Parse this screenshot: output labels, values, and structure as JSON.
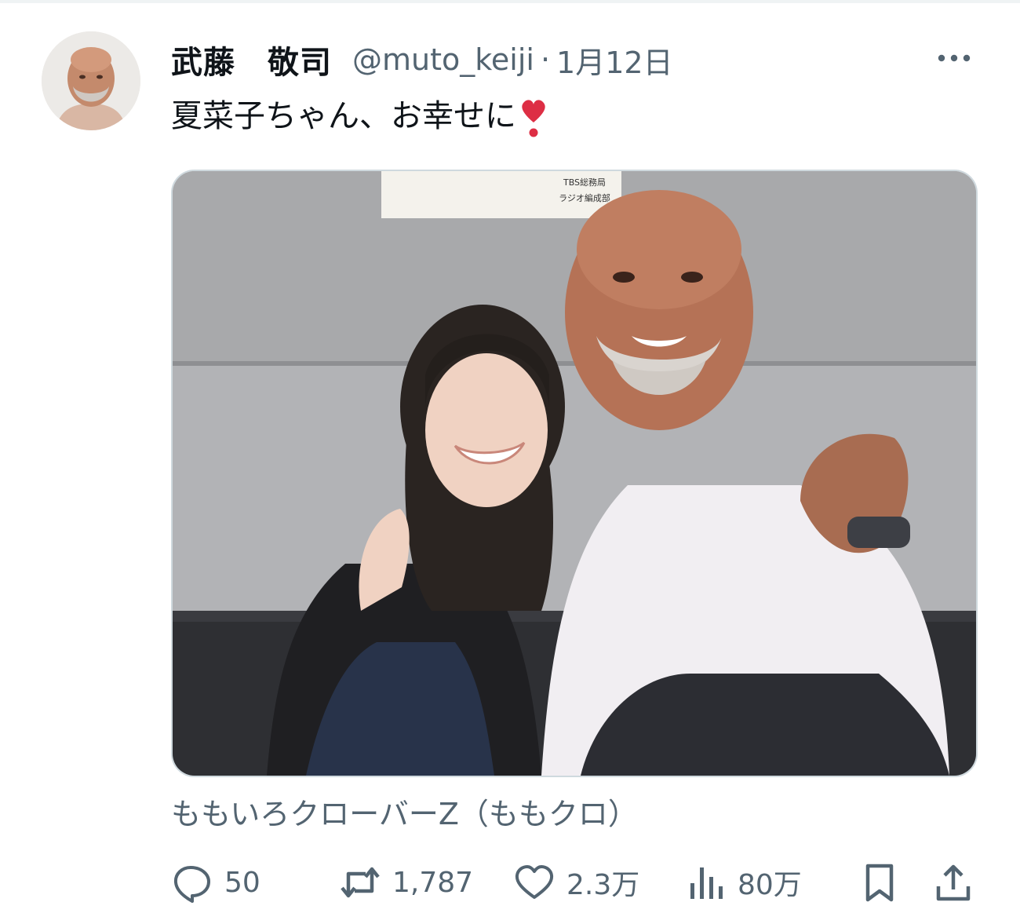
{
  "tweet": {
    "display_name": "武藤　敬司",
    "handle": "@muto_keiji",
    "separator": "·",
    "date": "1月12日",
    "text": "夏菜子ちゃん、お幸せに",
    "emoji": "heavy-heart-exclamation",
    "photo_caption": "TBS総務局\nラジオ編成部",
    "tag": "ももいろクローバーZ（ももクロ）"
  },
  "actions": {
    "replies": "50",
    "retweets": "1,787",
    "likes": "2.3万",
    "views": "80万"
  },
  "colors": {
    "text_primary": "#0f1419",
    "text_secondary": "#536471",
    "border": "#cfd9de",
    "emoji_red": "#dd2e44"
  },
  "icons": [
    "more-icon",
    "reply-icon",
    "retweet-icon",
    "like-icon",
    "views-icon",
    "bookmark-icon",
    "share-icon"
  ]
}
